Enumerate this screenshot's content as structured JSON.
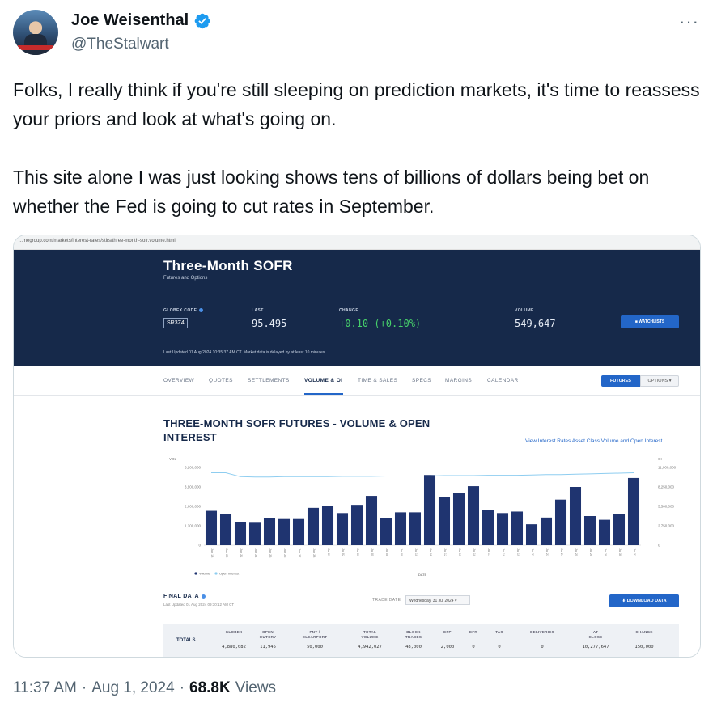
{
  "author": {
    "display_name": "Joe Weisenthal",
    "handle": "@TheStalwart"
  },
  "tweet": {
    "paragraphs": [
      "Folks, I really think if you're still sleeping on prediction markets, it's time to reassess your priors and look at what's going on.",
      "This site alone I was just looking shows tens of billions of dollars being bet on whether the Fed is going to cut rates in September."
    ]
  },
  "meta": {
    "time": "11:37 AM",
    "sep1": "·",
    "date": "Aug 1, 2024",
    "sep2": "·",
    "views_count": "68.8K",
    "views_label": "Views"
  },
  "screenshot": {
    "url": "...megroup.com/markets/interest-rates/stirs/three-month-sofr.volume.html",
    "title": "Three-Month SOFR",
    "subtitle": "Futures and Options",
    "globex_label": "GLOBEX CODE",
    "globex_code": "SR3Z4",
    "last_label": "LAST",
    "last_value": "95.495",
    "change_label": "CHANGE",
    "change_value": "+0.10 (+0.10%)",
    "volume_label": "VOLUME",
    "volume_value": "549,647",
    "watchlists": "WATCHLISTS",
    "updated": "Last Updated 01 Aug 2024 10:35:37 AM CT.   Market data is delayed by at least 10 minutes",
    "tabs": [
      "OVERVIEW",
      "QUOTES",
      "SETTLEMENTS",
      "VOLUME & OI",
      "TIME & SALES",
      "SPECS",
      "MARGINS",
      "CALENDAR"
    ],
    "futures_btn": "FUTURES",
    "options_btn": "OPTIONS",
    "chart_title": "THREE-MONTH SOFR FUTURES - VOLUME & OPEN INTEREST",
    "chart_link": "View Interest Rates Asset Class Volume and Open Interest",
    "final_data": "FINAL DATA",
    "final_sub": "Last Updated 01 Aug 2024 09:30:12 AM CT",
    "trade_date_label": "TRADE DATE",
    "trade_date_value": "Wednesday, 31 Jul 2024",
    "download_btn": "DOWNLOAD DATA",
    "totals_label": "TOTALS",
    "totals": [
      {
        "h1": "GLOBEX",
        "h2": "",
        "v": "4,880,082"
      },
      {
        "h1": "OPEN",
        "h2": "OUTCRY",
        "v": "11,945"
      },
      {
        "h1": "PNT /",
        "h2": "CLEARPORT",
        "v": "50,000"
      },
      {
        "h1": "TOTAL",
        "h2": "VOLUME",
        "v": "4,942,027"
      },
      {
        "h1": "BLOCK",
        "h2": "TRADES",
        "v": "48,000"
      },
      {
        "h1": "EFP",
        "h2": "",
        "v": "2,000"
      },
      {
        "h1": "EFR",
        "h2": "",
        "v": "0"
      },
      {
        "h1": "TAS",
        "h2": "",
        "v": "0"
      },
      {
        "h1": "DELIVERIES",
        "h2": "",
        "v": "0"
      },
      {
        "h1": "AT",
        "h2": "CLOSE",
        "v": "10,277,647"
      },
      {
        "h1": "CHANGE",
        "h2": "",
        "v": "150,000"
      }
    ]
  },
  "chart_data": {
    "type": "bar",
    "title": "THREE-MONTH SOFR FUTURES - VOLUME & OPEN INTEREST",
    "xlabel": "DATE",
    "ylabel": "VOL",
    "y2label": "OI",
    "ylim": [
      0,
      5200000
    ],
    "y2lim": [
      0,
      11000000
    ],
    "yticks": [
      "0",
      "1,300,000",
      "2,600,000",
      "3,900,000",
      "5,200,000"
    ],
    "y2ticks": [
      "0",
      "2,750,000",
      "5,500,000",
      "8,250,000",
      "11,000,000"
    ],
    "categories": [
      "Jun 18",
      "Jun 20",
      "Jun 21",
      "Jun 24",
      "Jun 25",
      "Jun 26",
      "Jun 27",
      "Jun 28",
      "Jul 01",
      "Jul 02",
      "Jul 03",
      "Jul 05",
      "Jul 08",
      "Jul 09",
      "Jul 10",
      "Jul 11",
      "Jul 12",
      "Jul 15",
      "Jul 16",
      "Jul 17",
      "Jul 18",
      "Jul 19",
      "Jul 22",
      "Jul 23",
      "Jul 24",
      "Jul 25",
      "Jul 26",
      "Jul 29",
      "Jul 30",
      "Jul 31"
    ],
    "series": [
      {
        "name": "Volume",
        "color": "#1f3470",
        "values": [
          2300000,
          2100000,
          1550000,
          1500000,
          1800000,
          1750000,
          1750000,
          2500000,
          2600000,
          2150000,
          2700000,
          3300000,
          1800000,
          2200000,
          2200000,
          4700000,
          3200000,
          3500000,
          3950000,
          2350000,
          2150000,
          2250000,
          1400000,
          1850000,
          3050000,
          3900000,
          1950000,
          1700000,
          2100000,
          4500000
        ]
      },
      {
        "name": "Open Interest",
        "color": "#8ecdf0",
        "values": [
          10250000,
          10250000,
          9700000,
          9650000,
          9650000,
          9700000,
          9700000,
          9700000,
          9700000,
          9750000,
          9750000,
          9750000,
          9800000,
          9800000,
          9800000,
          9800000,
          9850000,
          9850000,
          9850000,
          9900000,
          9900000,
          9900000,
          9950000,
          10000000,
          10000000,
          10050000,
          10100000,
          10150000,
          10200000,
          10250000
        ]
      }
    ],
    "legend": "bottom-left"
  }
}
